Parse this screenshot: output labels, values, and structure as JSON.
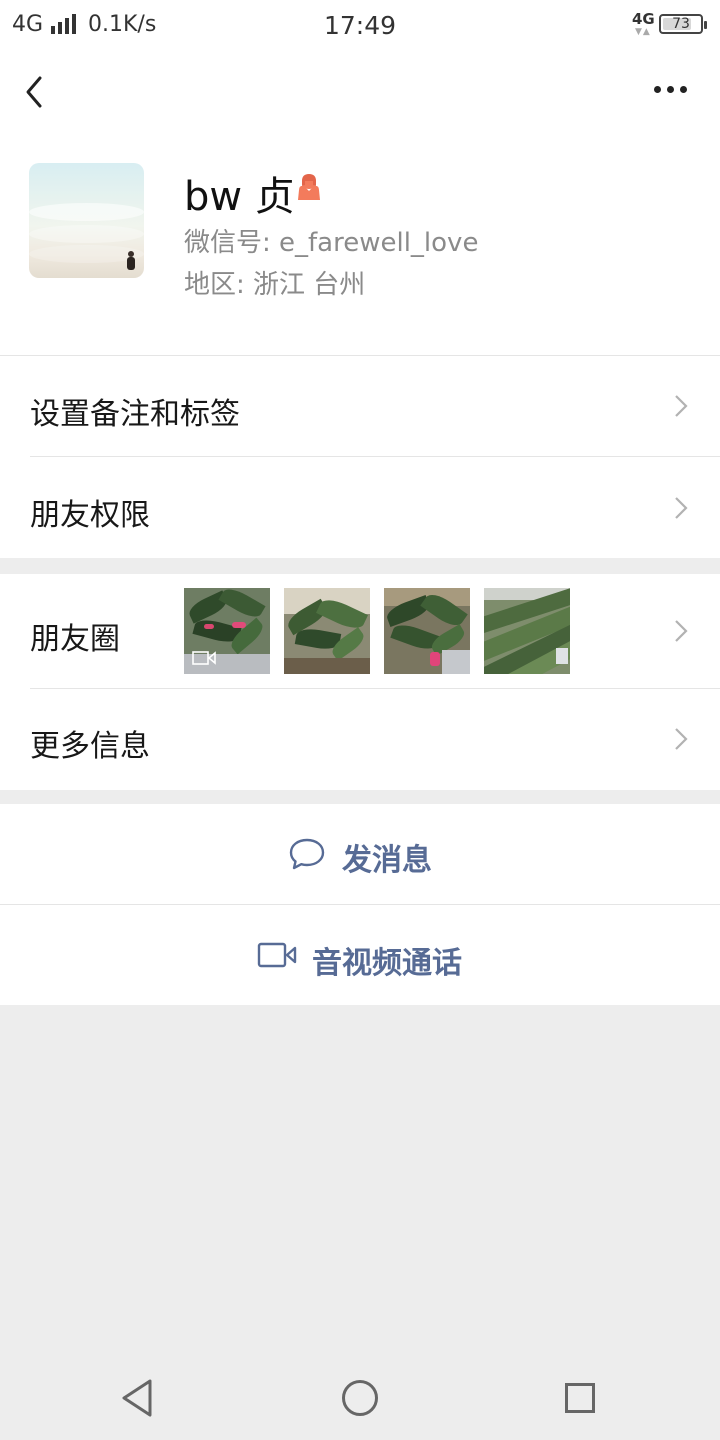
{
  "status_bar": {
    "network": "4G",
    "speed": "0.1K/s",
    "time": "17:49",
    "network_right": "4G",
    "battery": "73"
  },
  "profile": {
    "name": "bw 贞",
    "wechat_id": "微信号: e_farewell_love",
    "region": "地区: 浙江  台州",
    "gender_icon": "female-icon",
    "gender_color": "#f37b5c"
  },
  "rows": {
    "remark_tags": "设置备注和标签",
    "friend_permissions": "朋友权限",
    "moments": "朋友圈",
    "more_info": "更多信息"
  },
  "actions": {
    "message": "发消息",
    "call": "音视频通话",
    "link_color": "#576b95"
  }
}
